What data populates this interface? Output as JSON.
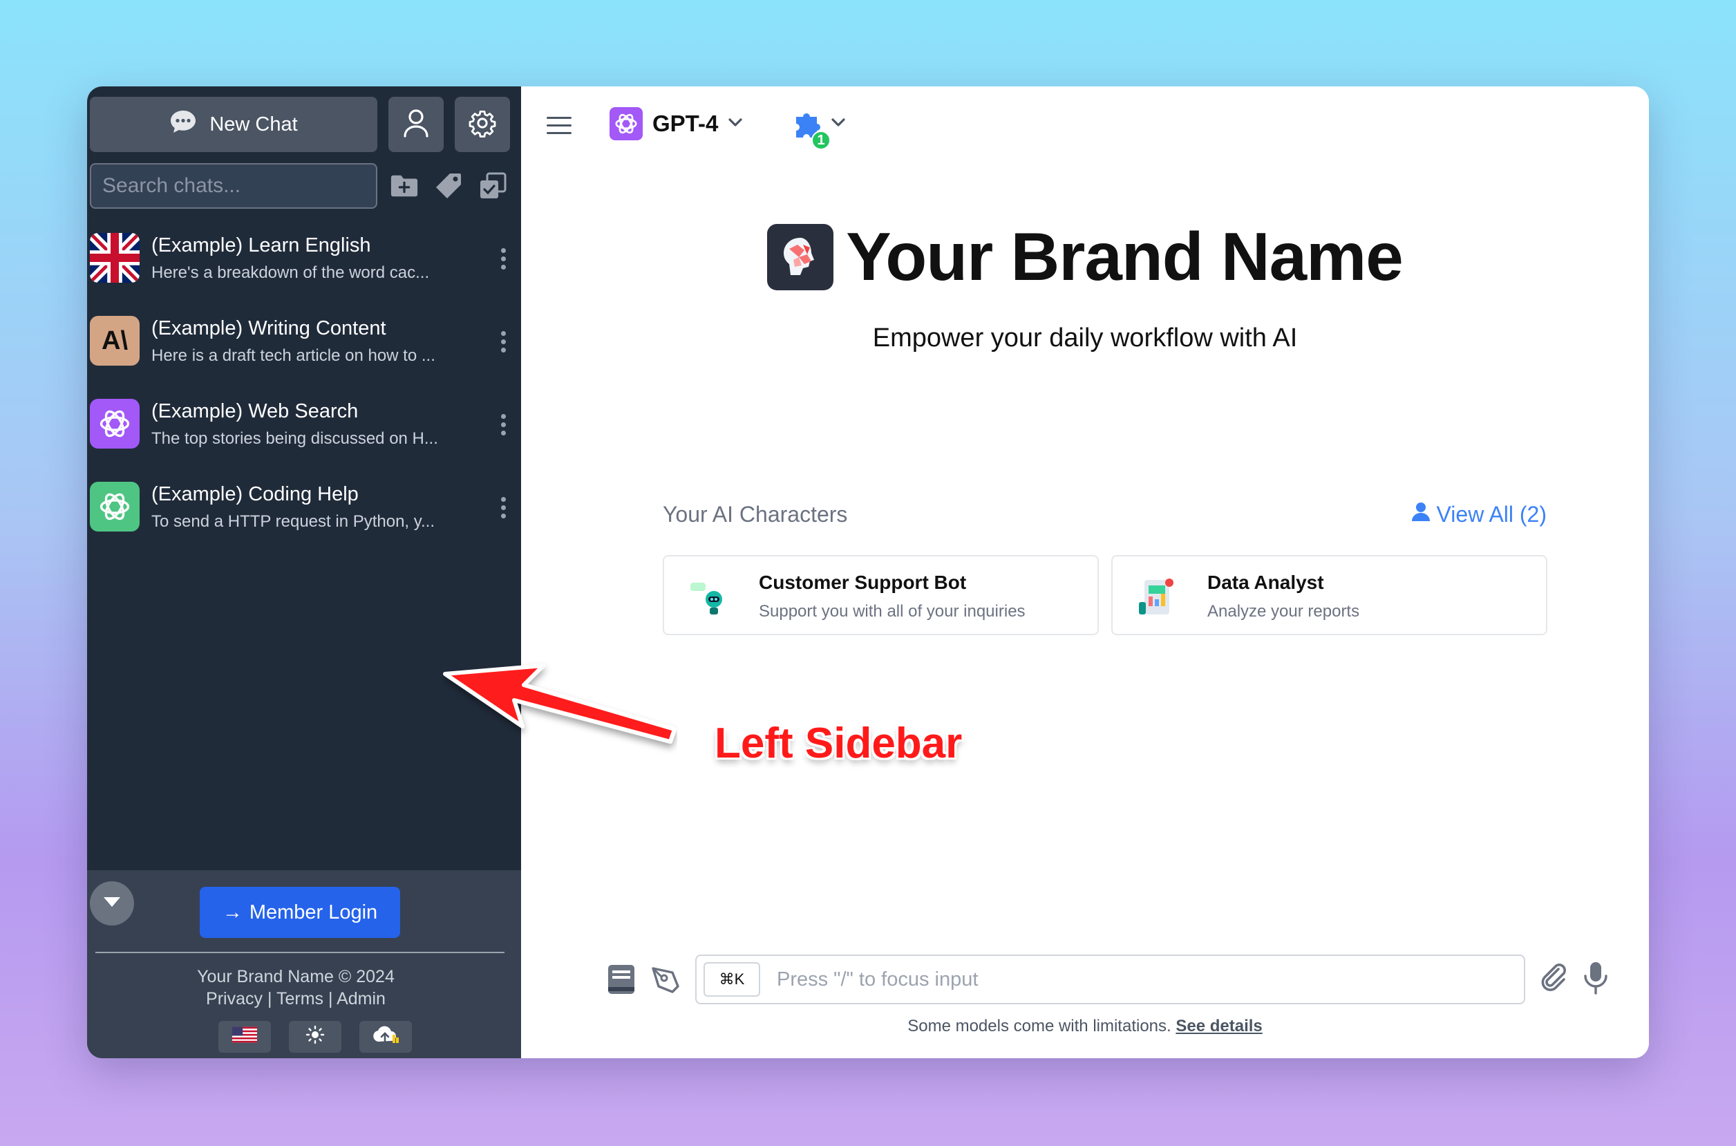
{
  "sidebar": {
    "new_chat_label": "New Chat",
    "search_placeholder": "Search chats...",
    "chats": [
      {
        "title": "(Example) Learn English",
        "preview": "Here's a breakdown of the word cac...",
        "avatar": "uk-flag-icon"
      },
      {
        "title": "(Example) Writing Content",
        "preview": "Here is a draft tech article on how to ...",
        "avatar": "anthropic-icon",
        "avatar_text": "A\\"
      },
      {
        "title": "(Example) Web Search",
        "preview": "The top stories being discussed on H...",
        "avatar": "openai-purple-icon"
      },
      {
        "title": "(Example) Coding Help",
        "preview": "To send a HTTP request in Python, y...",
        "avatar": "openai-green-icon"
      }
    ],
    "footer": {
      "login_label": "Member Login",
      "login_arrow": "→",
      "copyright": "Your Brand Name © 2024",
      "links": [
        "Privacy",
        "Terms",
        "Admin"
      ],
      "link_sep": "|"
    }
  },
  "main": {
    "model_name": "GPT-4",
    "plugin_count": "1",
    "brand_name": "Your Brand Name",
    "tagline": "Empower your daily workflow with AI",
    "characters_title": "Your AI Characters",
    "view_all": "View All (2)",
    "characters": [
      {
        "name": "Customer Support Bot",
        "desc": "Support you with all of your inquiries"
      },
      {
        "name": "Data Analyst",
        "desc": "Analyze your reports"
      }
    ],
    "input": {
      "shortcut": "⌘K",
      "placeholder": "Press \"/\" to focus input"
    },
    "disclaimer": "Some models come with limitations.",
    "disclaimer_link": "See details"
  },
  "annotation": {
    "label": "Left Sidebar"
  },
  "colors": {
    "sidebar_bg": "#202b3a",
    "accent_blue": "#2563eb",
    "annotation_red": "#ff1a1a"
  }
}
